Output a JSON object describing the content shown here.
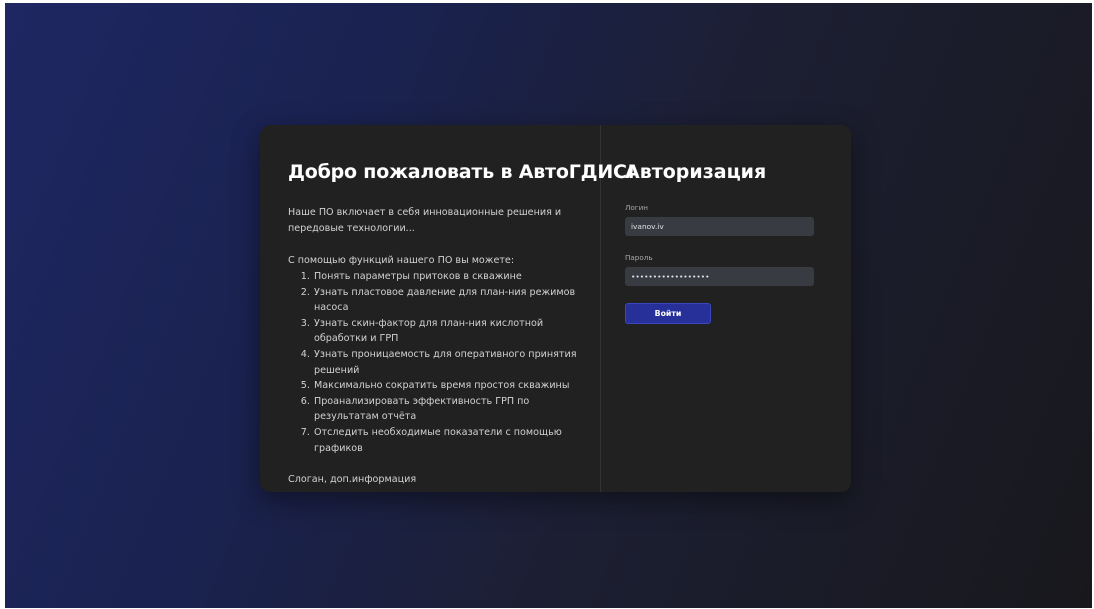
{
  "welcome": {
    "title": "Добро пожаловать в АвтоГДИС!",
    "intro": "Наше ПО включает в себя инновационные решения и передовые технологии...",
    "features_heading": "С помощью функций нашего ПО вы можете:",
    "features": [
      "Понять параметры притоков в скважине",
      "Узнать пластовое давление для план-ния режимов насоса",
      "Узнать скин-фактор для план-ния кислотной обработки и ГРП",
      "Узнать проницаемость для оперативного принятия решений",
      "Максимально сократить время простоя скважины",
      "Проанализировать эффективность ГРП по результатам отчёта",
      "Отследить необходимые показатели с помощью графиков"
    ],
    "slogan": "Слоган, доп.информация"
  },
  "auth": {
    "title": "Авторизация",
    "login_label": "Логин",
    "login_value": "ivanov.iv",
    "password_label": "Пароль",
    "password_value": "••••••••••••••••••",
    "submit_label": "Войти"
  },
  "colors": {
    "card_background": "#212121",
    "input_background": "#383b42",
    "button_background": "#272f99",
    "text_primary": "#ffffff"
  }
}
